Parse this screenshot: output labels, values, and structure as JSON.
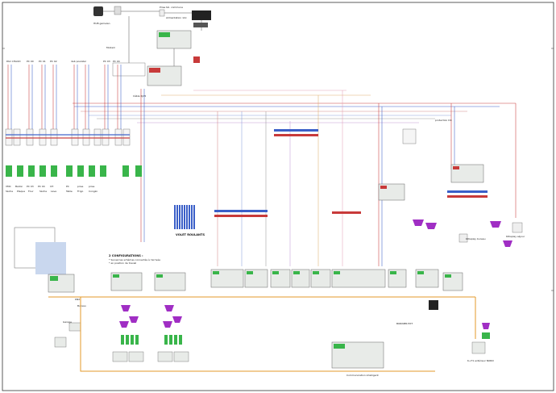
{
  "labels": {
    "hub": "HUB gamelan",
    "prise_tel": "Prise tél. commune",
    "alim": "Alimentation 12v",
    "rack_modem": "Modem",
    "cable_rj45": "Câble RJ45",
    "sect_col": [
      "PAC CHAUD",
      "PC 00",
      "PC 01",
      "PC 02",
      "deb pouls",
      "dal",
      "PC 03",
      "PC 04"
    ],
    "sect_bot_1": [
      "VMC",
      "Ballon",
      "PC 03",
      "PC 04",
      "CH",
      "PC",
      "prise",
      "prise"
    ],
    "sect_bot_2": [
      "Sèche",
      "Plaque",
      "Four",
      "Sèche",
      "Lave",
      "Table",
      "Frigo",
      "Congél."
    ],
    "volet_roulants": "VOLET ROULANTS",
    "volet_group": "VOLET ROULANTS",
    "zone_notes": [
      "Gamme chauffage",
      "Boitier cuisine",
      "Sonde ext.",
      "Sonde int."
    ],
    "configuration": "2 CONFIGURATIONS :",
    "config_note_1": "* Suivez les schémas connectés à l'arrivée",
    "config_note_2": "* en position de travail",
    "bureau": "Bureau",
    "garage": "Garage",
    "kdisplay_bureau": "KDisplay bureau",
    "kdisplay_sejour": "KDisplay séjour",
    "exterieur": "K+T1 extérieur NORD",
    "comm_intelligent": "Communication intelligent",
    "bus_knx": "KNX",
    "onduleur": "Onduleur",
    "protection": "protection DC",
    "routeur": "Routeur",
    "switch": "Switch",
    "sortie": "Sortie",
    "boitier_ext": "BORNIER EXT",
    "relais_label": "Relais / Sorties"
  },
  "colors": {
    "knx_bus": "#e39a2a",
    "line_blue": "#3a5fc8",
    "line_red": "#c83a3a",
    "line_green": "#2f9e4a",
    "line_purple": "#a02ec4",
    "line_grey": "#7a7a7a",
    "device_green": "#39b54a",
    "device_body": "#e8ebe8"
  }
}
